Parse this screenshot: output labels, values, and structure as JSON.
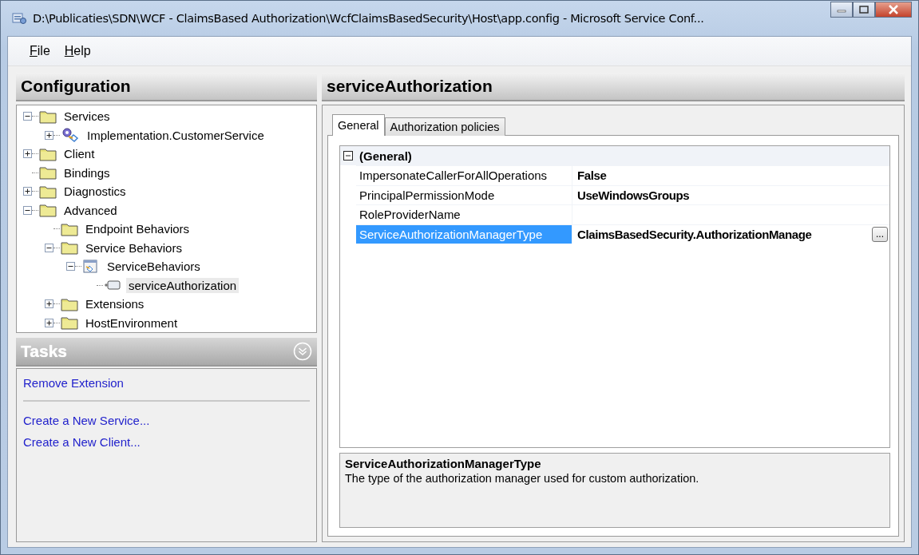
{
  "window": {
    "title": "D:\\Publicaties\\SDN\\WCF - ClaimsBased Authorization\\WcfClaimsBasedSecurity\\Host\\app.config - Microsoft Service Conf..."
  },
  "menu": [
    {
      "label": "File"
    },
    {
      "label": "Help"
    }
  ],
  "configuration": {
    "title": "Configuration",
    "tree": [
      {
        "label": "Services",
        "kind": "folder",
        "expanded": true,
        "selected": false,
        "children": [
          {
            "label": "Implementation.CustomerService",
            "kind": "service",
            "expanded": false,
            "selected": false
          }
        ]
      },
      {
        "label": "Client",
        "kind": "folder",
        "expanded": false,
        "selected": false
      },
      {
        "label": "Bindings",
        "kind": "folder",
        "selected": false
      },
      {
        "label": "Diagnostics",
        "kind": "folder",
        "expanded": false,
        "selected": false
      },
      {
        "label": "Advanced",
        "kind": "folder",
        "expanded": true,
        "selected": false,
        "children": [
          {
            "label": "Endpoint Behaviors",
            "kind": "folder",
            "selected": false
          },
          {
            "label": "Service Behaviors",
            "kind": "folder",
            "expanded": true,
            "selected": false,
            "children": [
              {
                "label": "ServiceBehaviors",
                "kind": "behavior",
                "expanded": true,
                "selected": false,
                "children": [
                  {
                    "label": "serviceAuthorization",
                    "kind": "element",
                    "selected": true
                  }
                ]
              }
            ]
          },
          {
            "label": "Extensions",
            "kind": "folder",
            "expanded": false,
            "selected": false
          },
          {
            "label": "HostEnvironment",
            "kind": "folder",
            "expanded": false,
            "selected": false
          }
        ]
      }
    ]
  },
  "tasks": {
    "title": "Tasks",
    "groups": [
      [
        "Remove Extension"
      ],
      [
        "Create a New Service...",
        "Create a New Client..."
      ]
    ]
  },
  "detail": {
    "title": "serviceAuthorization",
    "tabs": [
      {
        "label": "General",
        "selected": true
      },
      {
        "label": "Authorization policies",
        "selected": false
      }
    ],
    "category": {
      "label": "(General)",
      "expanded": true
    },
    "properties": [
      {
        "name": "ImpersonateCallerForAllOperations",
        "value": "False",
        "selected": false
      },
      {
        "name": "PrincipalPermissionMode",
        "value": "UseWindowsGroups",
        "selected": false
      },
      {
        "name": "RoleProviderName",
        "selected": false
      },
      {
        "name": "ServiceAuthorizationManagerType",
        "value": "ClaimsBasedSecurity.AuthorizationManage",
        "selected": true,
        "button": "..."
      }
    ],
    "help": {
      "title": "ServiceAuthorizationManagerType",
      "text": "The type of the authorization manager used for custom authorization."
    }
  }
}
